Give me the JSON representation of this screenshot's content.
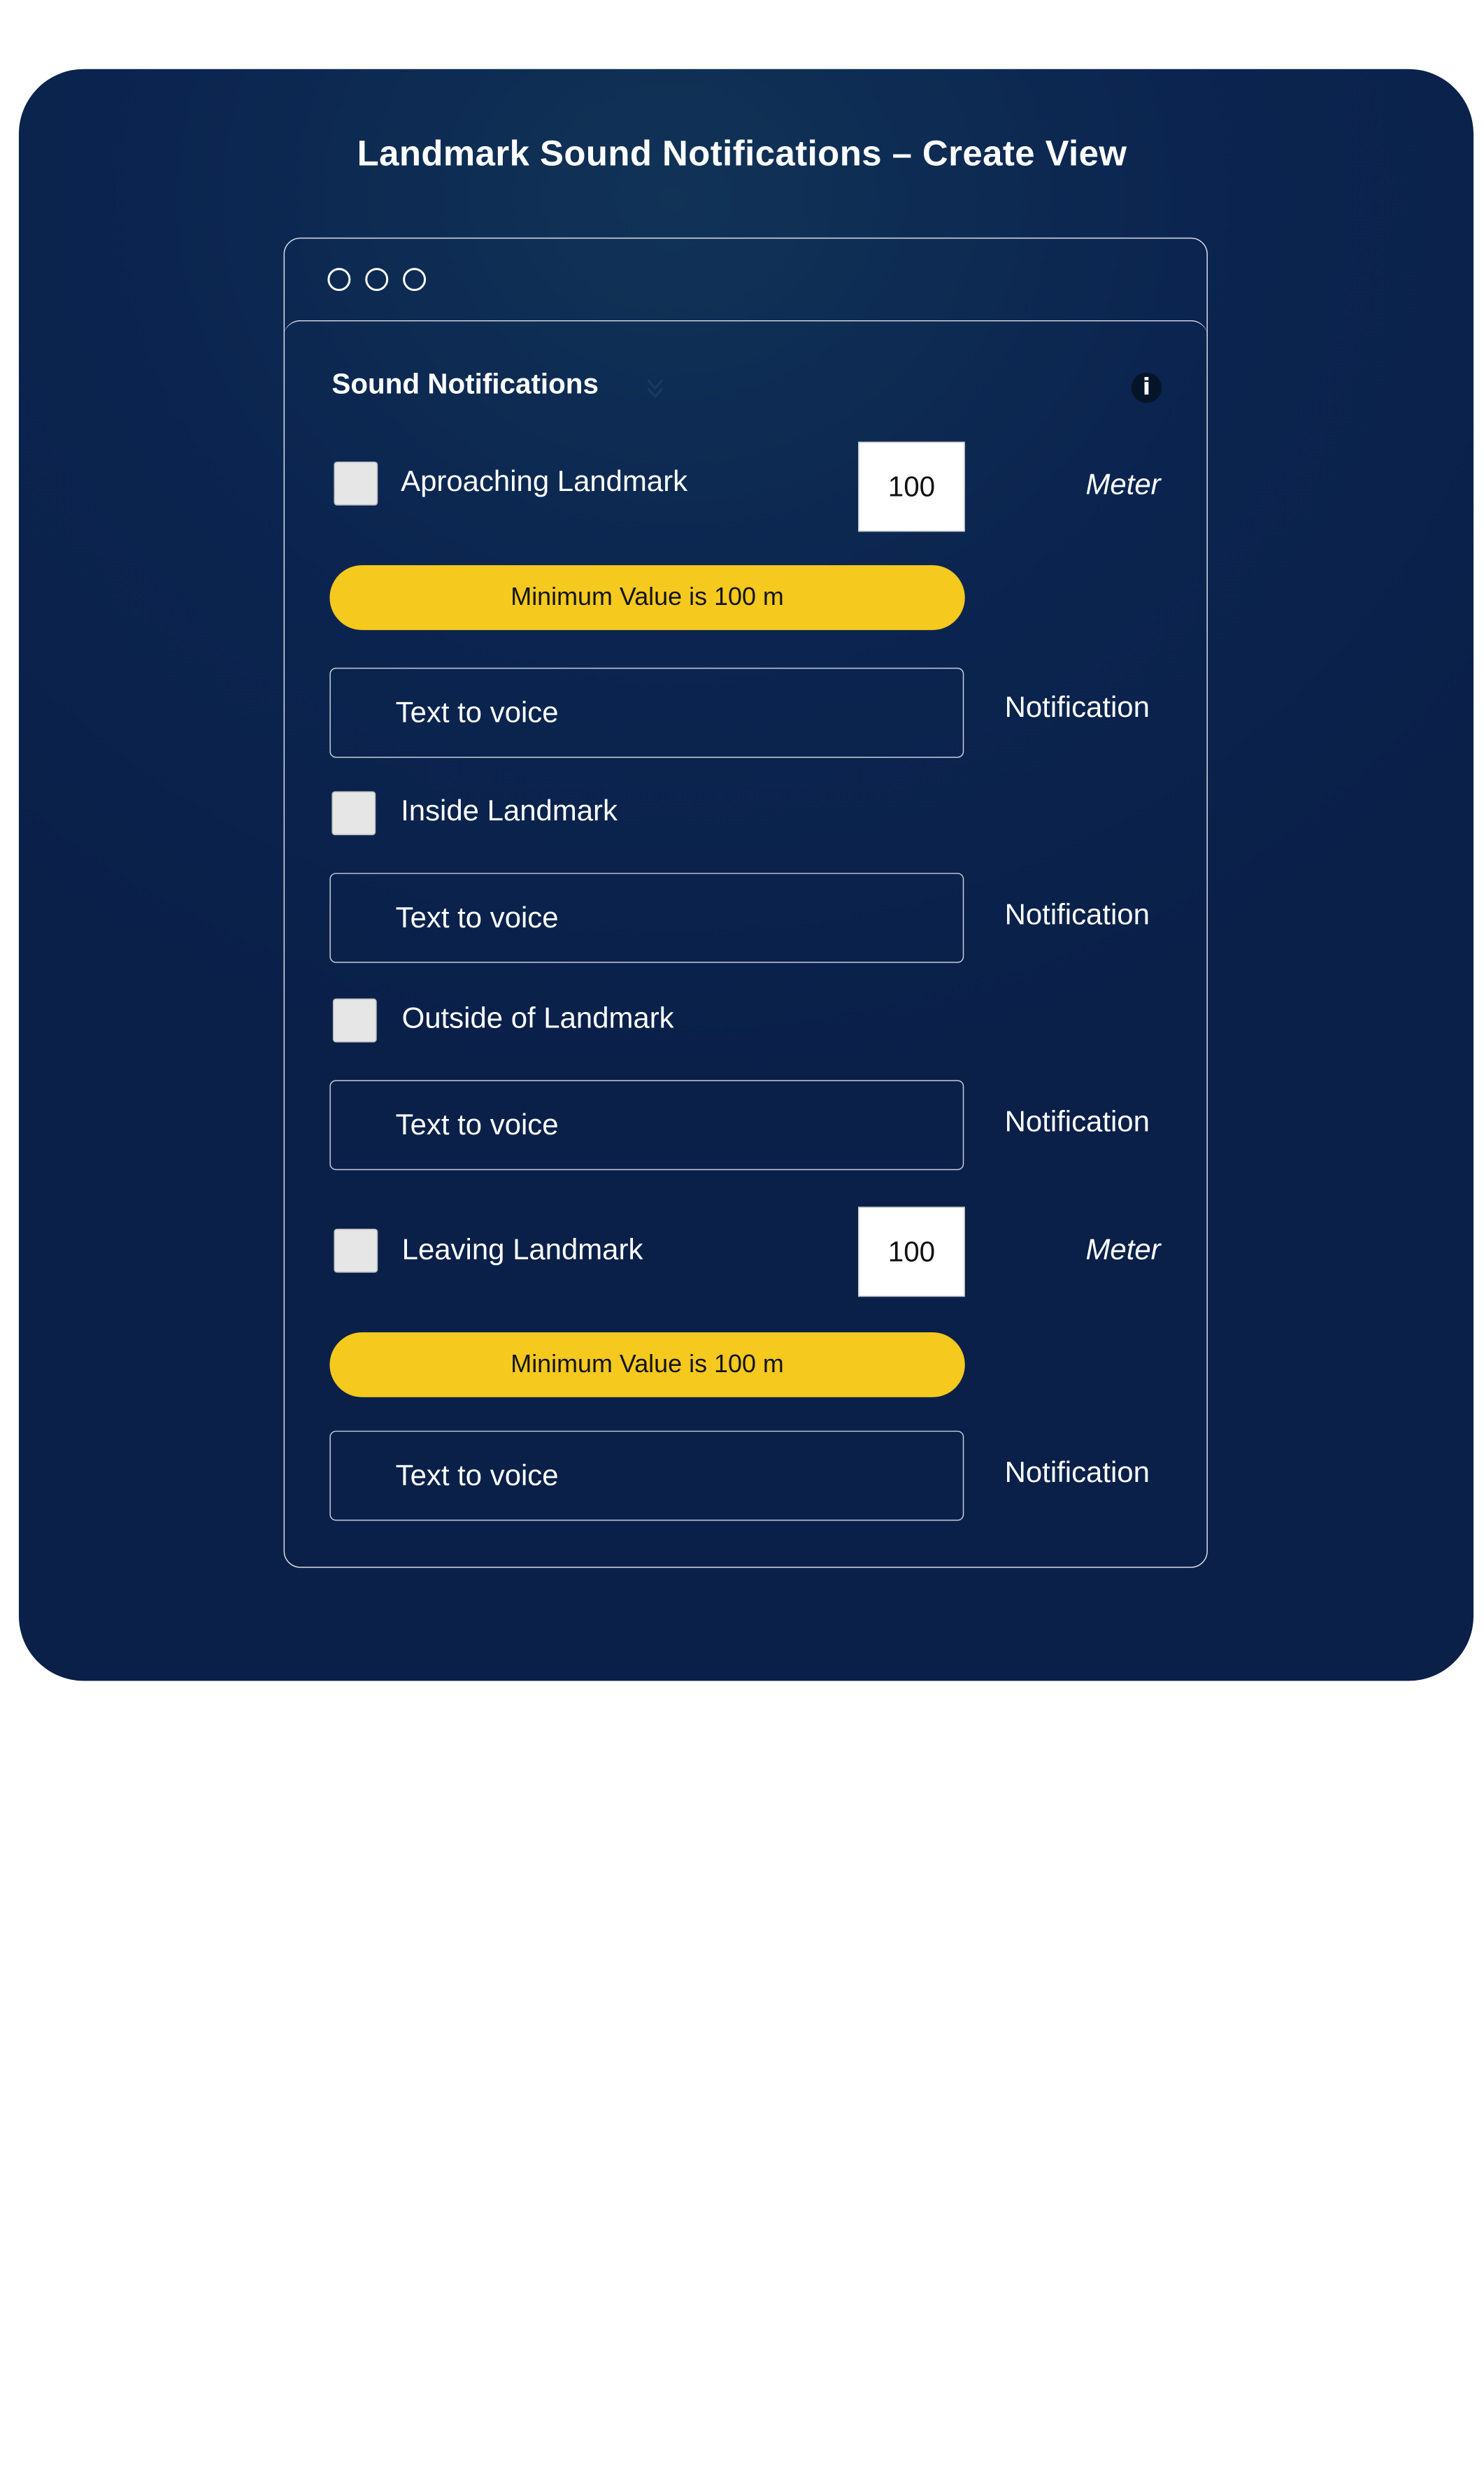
{
  "page": {
    "title": "Landmark Sound Notifications – Create View"
  },
  "section": {
    "title": "Sound Notifications",
    "info_glyph": "i"
  },
  "rows": {
    "approaching": {
      "label": "Aproaching Landmark",
      "distance": "100",
      "unit": "Meter",
      "warning": "Minimum Value is 100 m",
      "placeholder": "Text to voice",
      "type": "Notification"
    },
    "inside": {
      "label": "Inside Landmark",
      "placeholder": "Text to voice",
      "type": "Notification"
    },
    "outside": {
      "label": "Outside of Landmark",
      "placeholder": "Text to voice",
      "type": "Notification"
    },
    "leaving": {
      "label": "Leaving Landmark",
      "distance": "100",
      "unit": "Meter",
      "warning": "Minimum Value is 100 m",
      "placeholder": "Text to voice",
      "type": "Notification"
    }
  },
  "colors": {
    "background": "#0b2550",
    "accent": "#f5c91e",
    "text": "#ffffff"
  }
}
